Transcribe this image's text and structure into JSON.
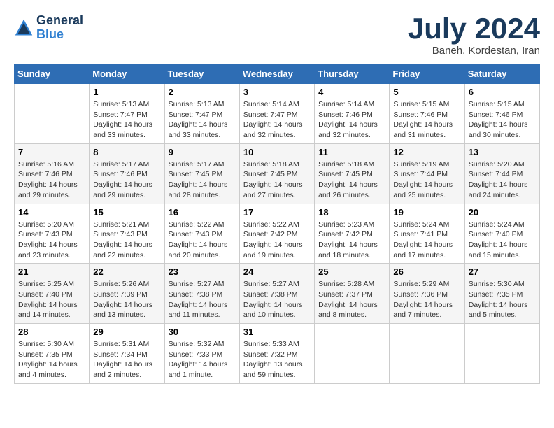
{
  "logo": {
    "line1": "General",
    "line2": "Blue"
  },
  "title": "July 2024",
  "subtitle": "Baneh, Kordestan, Iran",
  "days_of_week": [
    "Sunday",
    "Monday",
    "Tuesday",
    "Wednesday",
    "Thursday",
    "Friday",
    "Saturday"
  ],
  "weeks": [
    [
      {
        "day": "",
        "info": ""
      },
      {
        "day": "1",
        "info": "Sunrise: 5:13 AM\nSunset: 7:47 PM\nDaylight: 14 hours\nand 33 minutes."
      },
      {
        "day": "2",
        "info": "Sunrise: 5:13 AM\nSunset: 7:47 PM\nDaylight: 14 hours\nand 33 minutes."
      },
      {
        "day": "3",
        "info": "Sunrise: 5:14 AM\nSunset: 7:47 PM\nDaylight: 14 hours\nand 32 minutes."
      },
      {
        "day": "4",
        "info": "Sunrise: 5:14 AM\nSunset: 7:46 PM\nDaylight: 14 hours\nand 32 minutes."
      },
      {
        "day": "5",
        "info": "Sunrise: 5:15 AM\nSunset: 7:46 PM\nDaylight: 14 hours\nand 31 minutes."
      },
      {
        "day": "6",
        "info": "Sunrise: 5:15 AM\nSunset: 7:46 PM\nDaylight: 14 hours\nand 30 minutes."
      }
    ],
    [
      {
        "day": "7",
        "info": "Sunrise: 5:16 AM\nSunset: 7:46 PM\nDaylight: 14 hours\nand 29 minutes."
      },
      {
        "day": "8",
        "info": "Sunrise: 5:17 AM\nSunset: 7:46 PM\nDaylight: 14 hours\nand 29 minutes."
      },
      {
        "day": "9",
        "info": "Sunrise: 5:17 AM\nSunset: 7:45 PM\nDaylight: 14 hours\nand 28 minutes."
      },
      {
        "day": "10",
        "info": "Sunrise: 5:18 AM\nSunset: 7:45 PM\nDaylight: 14 hours\nand 27 minutes."
      },
      {
        "day": "11",
        "info": "Sunrise: 5:18 AM\nSunset: 7:45 PM\nDaylight: 14 hours\nand 26 minutes."
      },
      {
        "day": "12",
        "info": "Sunrise: 5:19 AM\nSunset: 7:44 PM\nDaylight: 14 hours\nand 25 minutes."
      },
      {
        "day": "13",
        "info": "Sunrise: 5:20 AM\nSunset: 7:44 PM\nDaylight: 14 hours\nand 24 minutes."
      }
    ],
    [
      {
        "day": "14",
        "info": "Sunrise: 5:20 AM\nSunset: 7:43 PM\nDaylight: 14 hours\nand 23 minutes."
      },
      {
        "day": "15",
        "info": "Sunrise: 5:21 AM\nSunset: 7:43 PM\nDaylight: 14 hours\nand 22 minutes."
      },
      {
        "day": "16",
        "info": "Sunrise: 5:22 AM\nSunset: 7:43 PM\nDaylight: 14 hours\nand 20 minutes."
      },
      {
        "day": "17",
        "info": "Sunrise: 5:22 AM\nSunset: 7:42 PM\nDaylight: 14 hours\nand 19 minutes."
      },
      {
        "day": "18",
        "info": "Sunrise: 5:23 AM\nSunset: 7:42 PM\nDaylight: 14 hours\nand 18 minutes."
      },
      {
        "day": "19",
        "info": "Sunrise: 5:24 AM\nSunset: 7:41 PM\nDaylight: 14 hours\nand 17 minutes."
      },
      {
        "day": "20",
        "info": "Sunrise: 5:24 AM\nSunset: 7:40 PM\nDaylight: 14 hours\nand 15 minutes."
      }
    ],
    [
      {
        "day": "21",
        "info": "Sunrise: 5:25 AM\nSunset: 7:40 PM\nDaylight: 14 hours\nand 14 minutes."
      },
      {
        "day": "22",
        "info": "Sunrise: 5:26 AM\nSunset: 7:39 PM\nDaylight: 14 hours\nand 13 minutes."
      },
      {
        "day": "23",
        "info": "Sunrise: 5:27 AM\nSunset: 7:38 PM\nDaylight: 14 hours\nand 11 minutes."
      },
      {
        "day": "24",
        "info": "Sunrise: 5:27 AM\nSunset: 7:38 PM\nDaylight: 14 hours\nand 10 minutes."
      },
      {
        "day": "25",
        "info": "Sunrise: 5:28 AM\nSunset: 7:37 PM\nDaylight: 14 hours\nand 8 minutes."
      },
      {
        "day": "26",
        "info": "Sunrise: 5:29 AM\nSunset: 7:36 PM\nDaylight: 14 hours\nand 7 minutes."
      },
      {
        "day": "27",
        "info": "Sunrise: 5:30 AM\nSunset: 7:35 PM\nDaylight: 14 hours\nand 5 minutes."
      }
    ],
    [
      {
        "day": "28",
        "info": "Sunrise: 5:30 AM\nSunset: 7:35 PM\nDaylight: 14 hours\nand 4 minutes."
      },
      {
        "day": "29",
        "info": "Sunrise: 5:31 AM\nSunset: 7:34 PM\nDaylight: 14 hours\nand 2 minutes."
      },
      {
        "day": "30",
        "info": "Sunrise: 5:32 AM\nSunset: 7:33 PM\nDaylight: 14 hours\nand 1 minute."
      },
      {
        "day": "31",
        "info": "Sunrise: 5:33 AM\nSunset: 7:32 PM\nDaylight: 13 hours\nand 59 minutes."
      },
      {
        "day": "",
        "info": ""
      },
      {
        "day": "",
        "info": ""
      },
      {
        "day": "",
        "info": ""
      }
    ]
  ]
}
